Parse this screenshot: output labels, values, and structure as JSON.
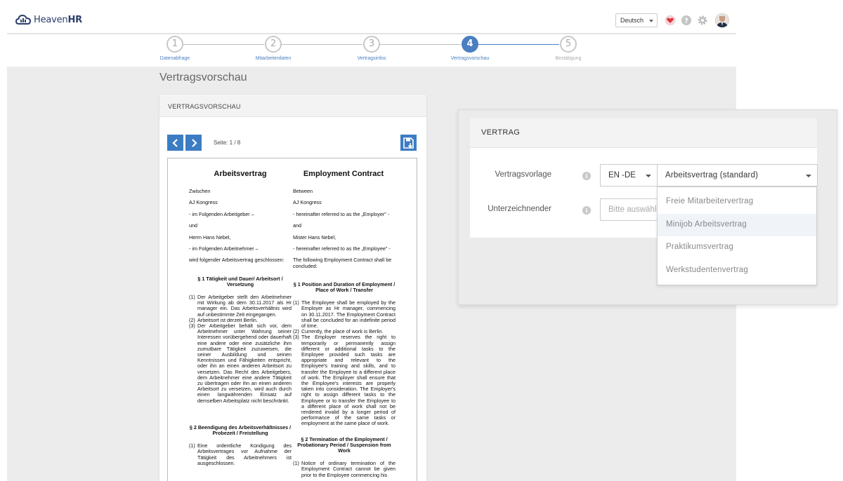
{
  "brand": {
    "name_part1": "Heaven",
    "name_part2": "HR"
  },
  "header": {
    "language": "Deutsch"
  },
  "steps": [
    {
      "number": "1",
      "label": "Datenabfrage"
    },
    {
      "number": "2",
      "label": "Mitarbeiterdaten"
    },
    {
      "number": "3",
      "label": "Vertragsinfos"
    },
    {
      "number": "4",
      "label": "Vertragsvorschau"
    },
    {
      "number": "5",
      "label": "Bestätigung"
    }
  ],
  "page": {
    "title": "Vertragsvorschau"
  },
  "preview": {
    "panel_title": "VERTRAGSVORSCHAU",
    "page_info": "Seite: 1 / 8",
    "document": {
      "left": {
        "title": "Arbeitsvertrag",
        "lines": [
          "Zwischen",
          "AJ Kongress",
          "- im Folgenden Arbeitgeber –",
          "und",
          "Herrn Hans Nebel,",
          "- im Folgenden Arbeitnehmer –",
          "wird folgender Arbeitsvertrag geschlossen:"
        ],
        "sec1": "§ 1 Tätigkeit und Dauer/ Arbeitsort / Versetzung",
        "items1": [
          {
            "n": "(1)",
            "t": "Der Arbeitgeber stellt den Arbeitnehmer mit Wirkung ab dem 30.11.2017 als Hr manager ein. Das Arbeitsverhältnis wird auf unbestimmte Zeit eingegangen."
          },
          {
            "n": "(2)",
            "t": "Arbeitsort ist derzeit Berlin."
          },
          {
            "n": "(3)",
            "t": "Der Arbeitgeber behält sich vor, dem Arbeitnehmer unter Wahrung seiner Interessen vorübergehend oder dauerhaft eine andere oder eine zusätzliche ihm zumutbare Tätigkeit zuzuweisen, die seiner Ausbildung und seinen Kenntnissen und Fähigkeiten entspricht, oder ihn an einen anderen Arbeitsort zu versetzen. Das Recht des Arbeitgebers, dem Arbeitnehmer eine andere Tätigkeit zu übertragen oder ihn an einen anderen Arbeitsort zu versetzen, wird auch durch einen langwährenden Einsatz auf demselben Arbeitsplatz nicht beschränkt."
          }
        ],
        "sec2": "§ 2 Beendigung des Arbeitsverhältnisses / Probezeit / Freistellung",
        "items2": [
          {
            "n": "(1)",
            "t": "Eine ordentliche Kündigung des Arbeitsvertrages vor Aufnahme der Tätigkeit des Arbeitnehmers ist ausgeschlossen."
          }
        ]
      },
      "right": {
        "title": "Employment Contract",
        "lines": [
          "Between",
          "AJ Kongress",
          "- hereinafter referred to as the „Employer\" -",
          "and",
          "Mister Hans Nebel,",
          "- hereinafter referred to as the „Employee\" -",
          "The following Employment Contract shall be concluded:"
        ],
        "sec1": "§ 1 Position and Duration of Employment / Place of Work / Transfer",
        "items1": [
          {
            "n": "(1)",
            "t": "The Employee shall be employed by the Employer as Hr manager, commencing on 30.11.2017. The Employment Contract shall be concluded for an indefinite period of time."
          },
          {
            "n": "(2)",
            "t": "Currently, the place of work is Berlin."
          },
          {
            "n": "(3)",
            "t": "The Employer reserves the right to temporarily or permanently assign different or additional tasks to the Employee provided such tasks are appropriate and relevant to the Employee's training and skills, and to transfer the Employee to a different place of work. The Employer shall ensure that the Employee's interests are properly taken into consideration. The Employer's right to assign different tasks to the Employee or to transfer the Employee to a different place of work shall not be rendered invalid by a longer period of performance of the same tasks or employment at the same place of work."
          }
        ],
        "sec2": "§ 2 Termination of the Employment / Probationary Period / Suspension from Work",
        "items2": [
          {
            "n": "(1)",
            "t": "Notice of ordinary termination of the Employment Contract cannot be given prior to the Employee commencing his"
          }
        ]
      }
    }
  },
  "contract": {
    "header": "VERTRAG",
    "template_label": "Vertragsvorlage",
    "signer_label": "Unterzeichnender",
    "language_value": "EN -DE",
    "template_value": "Arbeitsvertrag (standard)",
    "signer_placeholder": "Bitte auswählen",
    "options": [
      "Freie Mitarbeitervertrag",
      "Minijob Arbeitsvertrag",
      "Praktikumsvertrag",
      "Werkstudentenvertrag"
    ]
  },
  "colors": {
    "accent": "#3c7cc4",
    "brand": "#2c3e6b",
    "heart": "#e0313a"
  }
}
